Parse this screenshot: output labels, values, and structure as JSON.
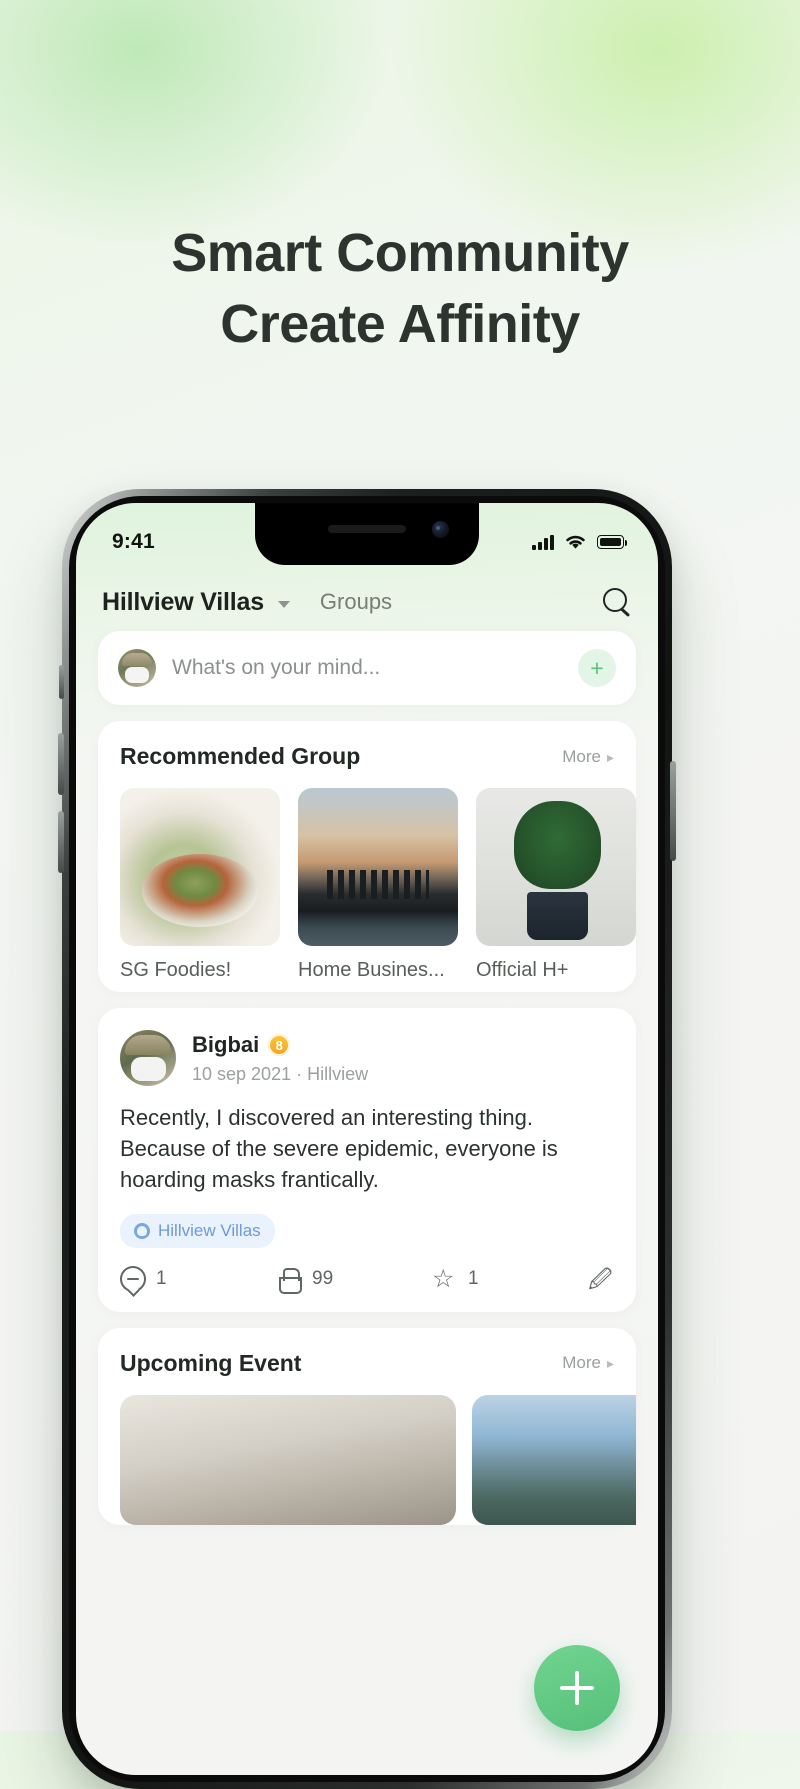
{
  "hero": {
    "line1": "Smart Community",
    "line2": "Create Affinity"
  },
  "status_bar": {
    "time": "9:41",
    "signal_icon": "cellular-signal-icon",
    "wifi_icon": "wifi-icon",
    "battery_icon": "battery-icon"
  },
  "navbar": {
    "title": "Hillview Villas",
    "dropdown_icon": "chevron-down-icon",
    "tab": "Groups",
    "search_icon": "search-icon"
  },
  "composer": {
    "placeholder": "What's on your mind...",
    "avatar": "user-avatar",
    "add_icon": "plus-icon"
  },
  "recommended": {
    "title": "Recommended Group",
    "more_label": "More",
    "more_icon": "chevron-right-icon",
    "groups": [
      {
        "name": "SG Foodies!",
        "image": "salad-bowl-photo"
      },
      {
        "name": "Home Busines...",
        "image": "city-skyline-photo"
      },
      {
        "name": "Official H+",
        "image": "potted-plant-photo"
      }
    ]
  },
  "post": {
    "author": "Bigbai",
    "badge": "8",
    "meta": "10 sep 2021 · Hillview",
    "body": "Recently, I discovered an interesting thing. Because of the severe epidemic, everyone is hoarding masks frantically.",
    "group_chip": "Hillview Villas",
    "chip_icon": "people-icon",
    "actions": [
      {
        "icon": "comment-icon",
        "count": "1"
      },
      {
        "icon": "thumbs-up-icon",
        "count": "99"
      },
      {
        "icon": "star-icon",
        "count": "1"
      },
      {
        "icon": "share-icon",
        "count": ""
      }
    ]
  },
  "upcoming": {
    "title": "Upcoming Event",
    "more_label": "More",
    "more_icon": "chevron-right-icon",
    "events": [
      {
        "image": "indoor-room-photo"
      },
      {
        "image": "mountain-lake-photo"
      }
    ]
  },
  "fab": {
    "icon": "plus-icon"
  },
  "colors": {
    "accent": "#5fbf7f",
    "chip_bg": "#eaf2fe",
    "chip_text": "#6d9ad8",
    "badge": "#f4a01e"
  }
}
